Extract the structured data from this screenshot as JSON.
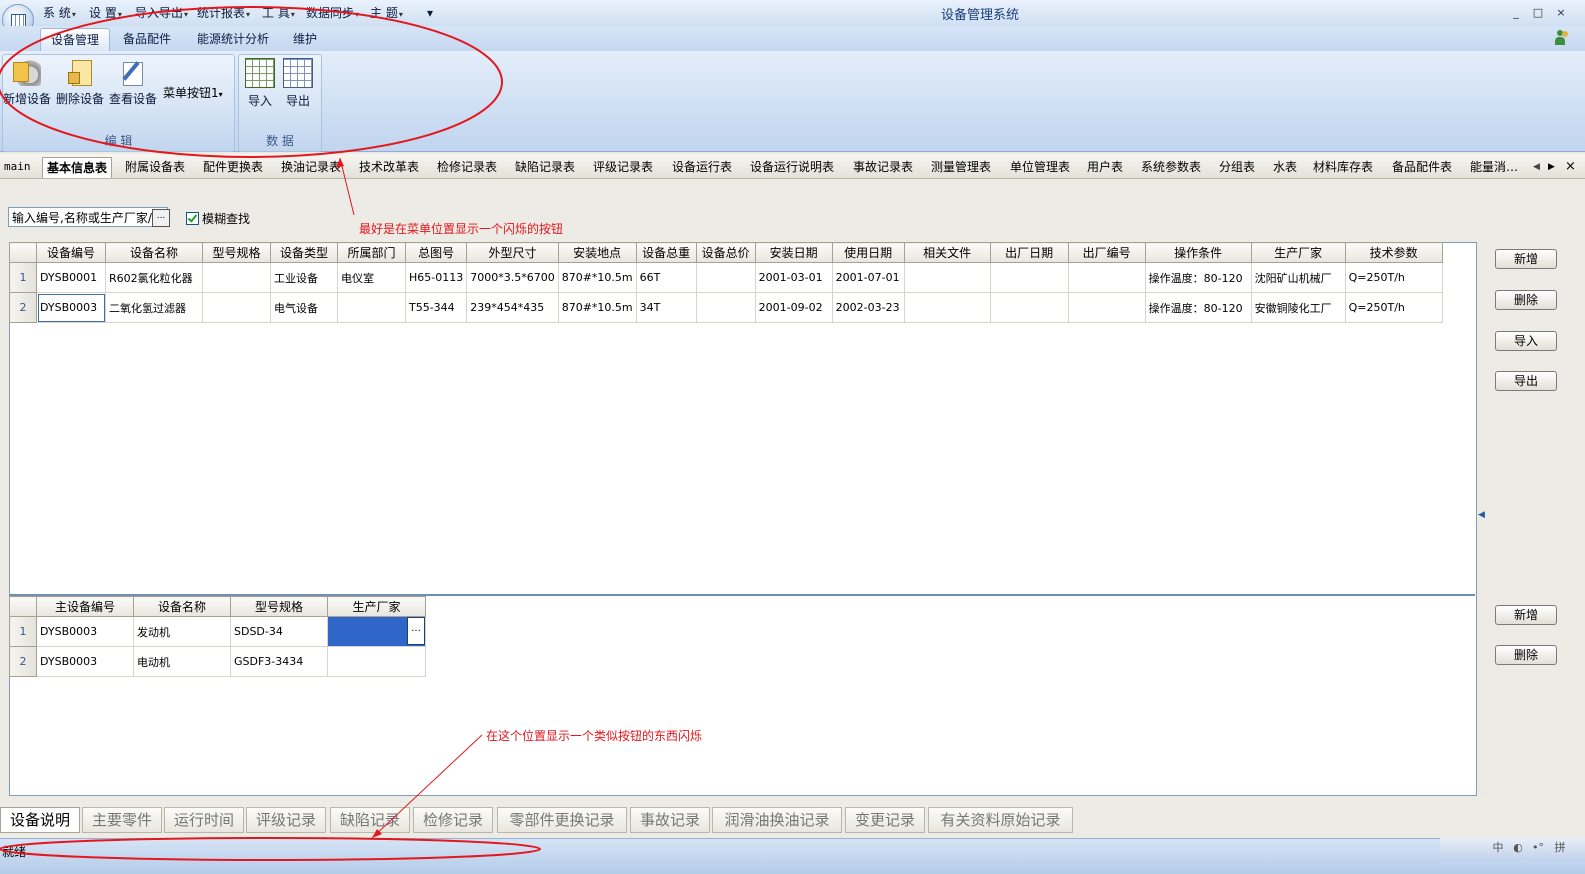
{
  "window": {
    "title": "设备管理系统",
    "menus": [
      "系 统",
      "设 置",
      "导入导出",
      "统计报表",
      "工 具",
      "数据同步",
      "主 题"
    ],
    "controls": {
      "minimize": "_",
      "maximize": "□",
      "close": "×"
    }
  },
  "ribbon": {
    "tabs": [
      "设备管理",
      "备品配件",
      "能源统计分析",
      "维护"
    ],
    "active_tab": "设备管理",
    "groups": [
      {
        "label": "编 辑",
        "buttons": [
          "新增设备",
          "删除设备",
          "查看设备",
          "菜单按钮1"
        ]
      },
      {
        "label": "数 据",
        "buttons": [
          "导入",
          "导出"
        ]
      }
    ]
  },
  "doc_tabs": {
    "items": [
      "main",
      "基本信息表",
      "附属设备表",
      "配件更换表",
      "换油记录表",
      "技术改革表",
      "检修记录表",
      "缺陷记录表",
      "评级记录表",
      "设备运行表",
      "设备运行说明表",
      "事故记录表",
      "测量管理表",
      "单位管理表",
      "用户表",
      "系统参数表",
      "分组表",
      "水表",
      "材料库存表",
      "备品配件表",
      "能量消…"
    ],
    "active": "基本信息表",
    "scroll_left": "◀",
    "scroll_right": "▶",
    "close": "×"
  },
  "search": {
    "placeholder": "输入编号,名称或生产厂家/",
    "button": "...",
    "fuzzy_label": "模糊查找"
  },
  "main_grid": {
    "columns": [
      "设备编号",
      "设备名称",
      "型号规格",
      "设备类型",
      "所属部门",
      "总图号",
      "外型尺寸",
      "安装地点",
      "设备总重",
      "设备总价",
      "安装日期",
      "使用日期",
      "相关文件",
      "出厂日期",
      "出厂编号",
      "操作条件",
      "生产厂家",
      "技术参数"
    ],
    "rows": [
      {
        "no": "1",
        "cells": [
          "DYSB0001",
          "R602氯化粒化器",
          "",
          "工业设备",
          "电仪室",
          "H65-0113",
          "7000*3.5*6700",
          "870#*10.5m",
          "66T",
          "",
          "2001-03-01",
          "2001-07-01",
          "",
          "",
          "",
          "操作温度：80-120",
          "沈阳矿山机械厂",
          "Q=250T/h"
        ]
      },
      {
        "no": "2",
        "cells": [
          "DYSB0003",
          "二氧化氢过滤器",
          "",
          "电气设备",
          "",
          "T55-344",
          "239*454*435",
          "870#*10.5m",
          "34T",
          "",
          "2001-09-02",
          "2002-03-23",
          "",
          "",
          "",
          "操作温度：80-120",
          "安徽铜陵化工厂",
          "Q=250T/h"
        ]
      }
    ]
  },
  "sub_grid": {
    "columns": [
      "主设备编号",
      "设备名称",
      "型号规格",
      "生产厂家"
    ],
    "rows": [
      {
        "no": "1",
        "cells": [
          "DYSB0003",
          "发动机",
          "SDSD-34",
          ""
        ]
      },
      {
        "no": "2",
        "cells": [
          "DYSB0003",
          "电动机",
          "GSDF3-3434",
          ""
        ]
      }
    ],
    "ellipsis": "..."
  },
  "side_buttons": {
    "top": [
      "新增",
      "删除",
      "导入",
      "导出"
    ],
    "bottom": [
      "新增",
      "删除"
    ],
    "collapse": "◀"
  },
  "annotations": {
    "note1": "最好是在菜单位置显示一个闪烁的按钮",
    "note2": "在这个位置显示一个类似按钮的东西闪烁",
    "color": "#e4171c"
  },
  "bottom_tabs": {
    "items": [
      "设备说明",
      "主要零件",
      "运行时间",
      "评级记录",
      "缺陷记录",
      "检修记录",
      "零部件更换记录",
      "事故记录",
      "润滑油换油记录",
      "变更记录",
      "有关资料原始记录"
    ],
    "active": "设备说明"
  },
  "status": {
    "text": "就绪",
    "icons": [
      "中",
      "◐",
      "•°",
      "拼"
    ]
  },
  "colors": {
    "selected_cell": "#2f66c8",
    "ribbon": "#cadcf2",
    "panel_border": "#7f9db9"
  }
}
